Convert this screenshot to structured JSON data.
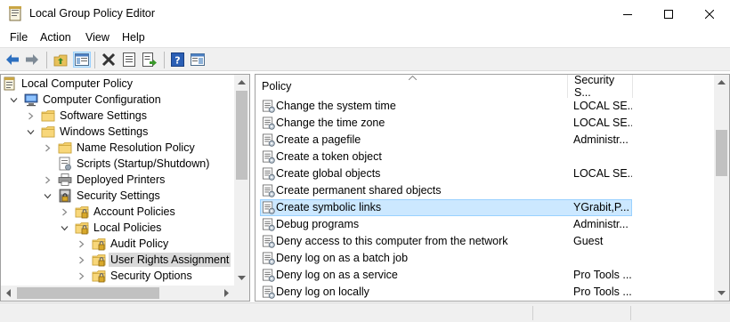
{
  "window": {
    "title": "Local Group Policy Editor",
    "icon": "policy-editor-icon"
  },
  "menu": [
    "File",
    "Action",
    "View",
    "Help"
  ],
  "toolbar": {
    "buttons": [
      "back-icon",
      "forward-icon",
      "up-folder-icon",
      "show-hide-tree-icon",
      "delete-icon",
      "properties-icon",
      "export-list-icon",
      "help-icon",
      "console-view-icon"
    ]
  },
  "tree": [
    {
      "label": "Local Computer Policy",
      "icon": "computer-policy-icon",
      "expander": "none",
      "level": 0
    },
    {
      "label": "Computer Configuration",
      "icon": "computer-icon",
      "expander": "expanded",
      "level": 1
    },
    {
      "label": "Software Settings",
      "icon": "folder-icon",
      "expander": "collapsed",
      "level": 2
    },
    {
      "label": "Windows Settings",
      "icon": "folder-icon",
      "expander": "expanded",
      "level": 2
    },
    {
      "label": "Name Resolution Policy",
      "icon": "folder-icon",
      "expander": "collapsed",
      "level": 3
    },
    {
      "label": "Scripts (Startup/Shutdown)",
      "icon": "script-icon",
      "expander": "none",
      "level": 3
    },
    {
      "label": "Deployed Printers",
      "icon": "printer-icon",
      "expander": "collapsed",
      "level": 3
    },
    {
      "label": "Security Settings",
      "icon": "security-settings-icon",
      "expander": "expanded",
      "level": 3
    },
    {
      "label": "Account Policies",
      "icon": "locked-folder-icon",
      "expander": "collapsed",
      "level": 4
    },
    {
      "label": "Local Policies",
      "icon": "locked-folder-icon",
      "expander": "expanded",
      "level": 4
    },
    {
      "label": "Audit Policy",
      "icon": "locked-folder-icon",
      "expander": "collapsed",
      "level": 5
    },
    {
      "label": "User Rights Assignment",
      "icon": "locked-folder-icon",
      "expander": "collapsed",
      "level": 5,
      "selected": true
    },
    {
      "label": "Security Options",
      "icon": "locked-folder-icon",
      "expander": "collapsed",
      "level": 5
    }
  ],
  "list": {
    "columns": [
      "Policy",
      "Security S..."
    ],
    "rows": [
      {
        "policy": "Change the system time",
        "setting": "LOCAL SE..."
      },
      {
        "policy": "Change the time zone",
        "setting": "LOCAL SE..."
      },
      {
        "policy": "Create a pagefile",
        "setting": "Administr..."
      },
      {
        "policy": "Create a token object",
        "setting": ""
      },
      {
        "policy": "Create global objects",
        "setting": "LOCAL SE..."
      },
      {
        "policy": "Create permanent shared objects",
        "setting": ""
      },
      {
        "policy": "Create symbolic links",
        "setting": "YGrabit,P...",
        "selected": true
      },
      {
        "policy": "Debug programs",
        "setting": "Administr..."
      },
      {
        "policy": "Deny access to this computer from the network",
        "setting": "Guest"
      },
      {
        "policy": "Deny log on as a batch job",
        "setting": ""
      },
      {
        "policy": "Deny log on as a service",
        "setting": "Pro Tools ..."
      },
      {
        "policy": "Deny log on locally",
        "setting": "Pro Tools ..."
      }
    ]
  },
  "colors": {
    "selection": "#cce8ff",
    "tree_selection": "#d9d9d9",
    "chrome": "#f0f0f0"
  }
}
